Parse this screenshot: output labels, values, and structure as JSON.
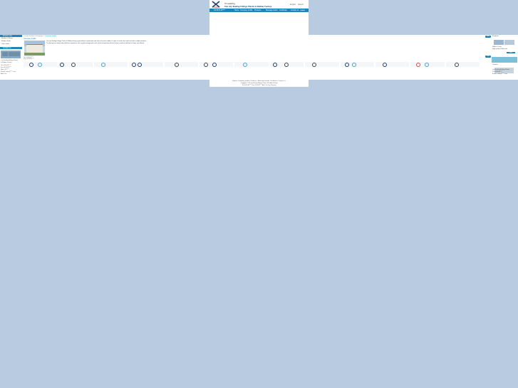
{
  "header": {
    "brand_top": "Tri-seaking",
    "brand_main": "Cixi city Sealing Fittings Plastic & Rubber Factory",
    "lang": "English",
    "search": "Search"
  },
  "nav": {
    "phone": "Tel:0574-63****",
    "items": [
      "Home",
      "Company profile",
      "Products",
      "Message board",
      "Certificate",
      "Contact us"
    ],
    "flags": "■ ■ ■"
  },
  "left": {
    "category_title": "Product List",
    "categories": [
      "Rubber O-Rings",
      "Rubber Seals",
      "Other items"
    ],
    "contact_title": "Contact us",
    "contact_lines": [
      "Cixi Sealing Fittings Plastic",
      "& Rubber Factory",
      "Tel: 0574-63****",
      "Fax: 0574-63****",
      "Mob: 135****",
      "E-mail: sales@****.com",
      "Add: Cixi"
    ]
  },
  "content": {
    "breadcrumb_home": "Current location: Homepage",
    "breadcrumb_current": "> Company profile",
    "title": "Company profile",
    "intro_lines": [
      "Cixi city Sealing Fittings Plastic & Rubber Factory specialized in production and sales of various rubber O-rings, oil seals, dust seals and other rubber products.",
      "The factory has advanced production equipment, strict quality management and a team of experienced technicians, products sold well at home and abroad."
    ],
    "contacts": [
      "Tel: 0574-63****",
      "Fax: 0574-63****"
    ]
  },
  "right": {
    "new_tag": "New",
    "new_title": "Products",
    "product_lines": [
      "Rubber O-ring",
      "High quality rubber seal"
    ],
    "more": "More",
    "hot_tag": "Hot",
    "hot_title": "Contact",
    "hot_lines": [
      "Cixi Sealing Fittings Plastic",
      "Tel: 0574-63****",
      "E-mail: sales@****.com"
    ]
  },
  "footer": {
    "nav": "Home | Company profile | Products | Message board | Certificate | Contact us",
    "copyright": "Copyright © Cixi city Sealing Fittings Plastic & Rubber Factory",
    "contact": "Tel: 0574-63****  Fax: 0574-63****  Add: Cixi City, Zhejiang"
  }
}
